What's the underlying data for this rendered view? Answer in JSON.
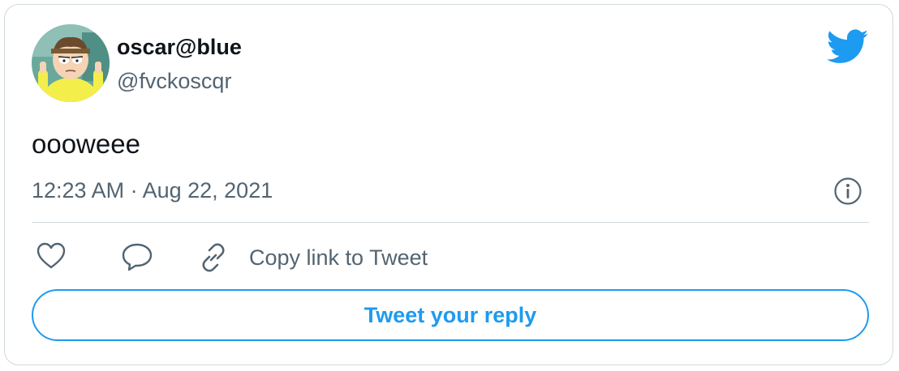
{
  "author": {
    "name": "oscar@blue",
    "handle": "@fvckoscqr"
  },
  "tweet": {
    "text": "oooweee",
    "timestamp": "12:23 AM · Aug 22, 2021"
  },
  "actions": {
    "copy_link_label": "Copy link to Tweet"
  },
  "reply": {
    "label": "Tweet your reply"
  },
  "icons": {
    "brand": "twitter-bird-icon",
    "info": "info-icon",
    "like": "heart-icon",
    "reply": "speech-bubble-icon",
    "copy": "link-icon"
  },
  "colors": {
    "accent": "#1d9bf0",
    "text": "#0f1419",
    "secondary": "#536471",
    "border": "#cfd9de"
  }
}
